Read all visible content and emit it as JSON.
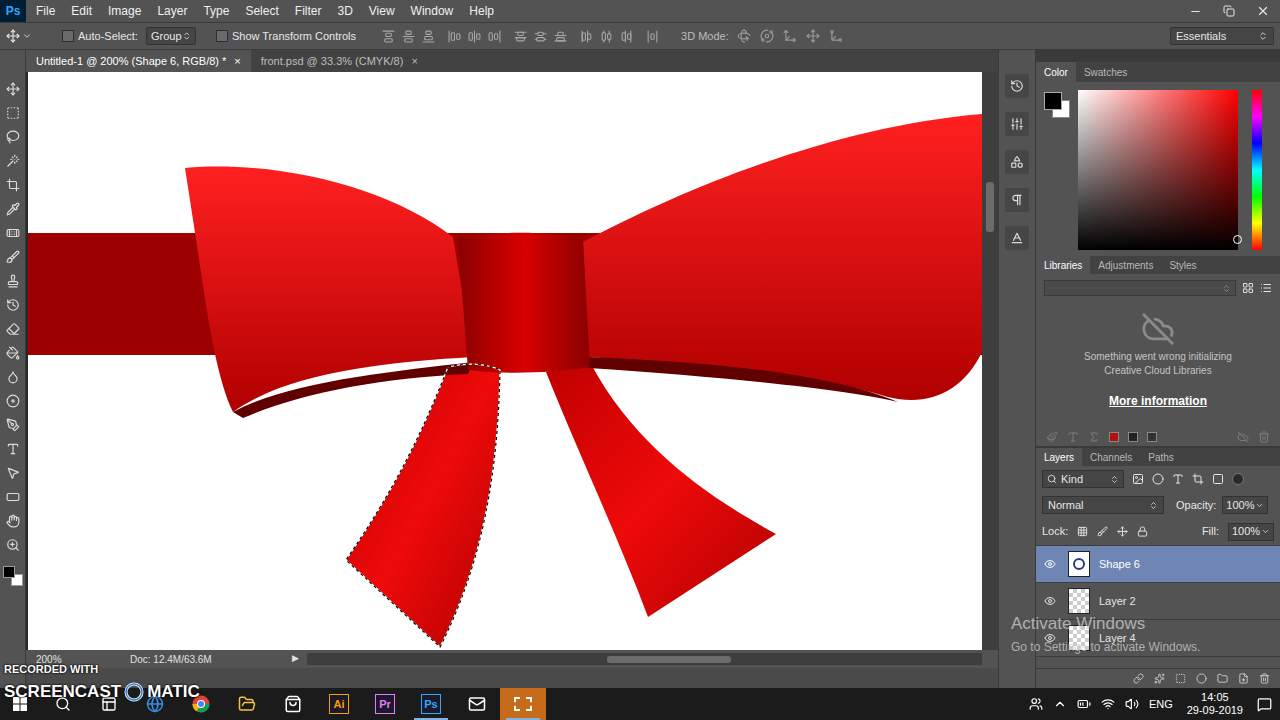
{
  "app_logo": "Ps",
  "menu": [
    "File",
    "Edit",
    "Image",
    "Layer",
    "Type",
    "Select",
    "Filter",
    "3D",
    "View",
    "Window",
    "Help"
  ],
  "options_bar": {
    "auto_select": {
      "label": "Auto-Select:",
      "checked": false
    },
    "group_dropdown": "Group",
    "show_transform": {
      "label": "Show Transform Controls",
      "checked": false
    },
    "mode_3d": "3D Mode:",
    "workspace": "Essentials"
  },
  "document_tabs": [
    {
      "title": "Untitled-1 @ 200% (Shape 6, RGB/8) *",
      "close": "×",
      "selected": true
    },
    {
      "title": "front.psd @ 33.3% (CMYK/8)",
      "close": "×",
      "selected": false
    }
  ],
  "canvas": {
    "selection_visible": true
  },
  "status_bar": {
    "zoom": "200%",
    "doc": "Doc: 12.4M/63.6M",
    "arrow": "▶"
  },
  "color_panel": {
    "tabs": [
      {
        "label": "Color",
        "selected": true
      },
      {
        "label": "Swatches",
        "selected": false
      }
    ],
    "foreground_color": "#000000",
    "background_color": "#ffffff",
    "hue_color": "#ff0000"
  },
  "libraries_panel": {
    "tabs": [
      {
        "label": "Libraries",
        "selected": true
      },
      {
        "label": "Adjustments",
        "selected": false
      },
      {
        "label": "Styles",
        "selected": false
      }
    ],
    "message": "Something went wrong initializing Creative Cloud Libraries",
    "link": "More information"
  },
  "layers_panel": {
    "tabs": [
      {
        "label": "Layers",
        "selected": true
      },
      {
        "label": "Channels",
        "selected": false
      },
      {
        "label": "Paths",
        "selected": false
      }
    ],
    "filter": "Kind",
    "blend_mode": "Normal",
    "opacity_label": "Opacity:",
    "opacity": "100%",
    "lock_label": "Lock:",
    "fill_label": "Fill:",
    "fill": "100%",
    "layers": [
      {
        "name": "Shape 6",
        "kind": "shape",
        "visible": true,
        "selected": true
      },
      {
        "name": "Layer 2",
        "kind": "pixel",
        "visible": true,
        "selected": false
      },
      {
        "name": "Layer 4",
        "kind": "pixel",
        "visible": true,
        "selected": false
      }
    ]
  },
  "windows_watermark": {
    "title": "Activate Windows",
    "subtitle": "Go to Settings to activate Windows."
  },
  "recorder_watermark": {
    "line1": "RECORDED WITH",
    "line2": "SCREENCAST",
    "line3": "MATIC"
  },
  "taskbar": {
    "apps": [
      {
        "kind": "search",
        "active": false
      },
      {
        "kind": "task-view",
        "active": false
      },
      {
        "kind": "edge",
        "active": false
      },
      {
        "kind": "chrome",
        "active": false
      },
      {
        "kind": "explorer",
        "active": false
      },
      {
        "kind": "store",
        "active": false
      },
      {
        "kind": "illustrator",
        "label": "Ai",
        "color": "#ff9a00",
        "active": false
      },
      {
        "kind": "premiere",
        "label": "Pr",
        "color": "#ea77ff",
        "active": false
      },
      {
        "kind": "photoshop",
        "label": "Ps",
        "color": "#31a8ff",
        "active": true
      },
      {
        "kind": "mail",
        "active": false
      },
      {
        "kind": "screencast",
        "active": true
      }
    ],
    "language": "ENG",
    "time": "14:05",
    "date": "29-09-2019"
  }
}
